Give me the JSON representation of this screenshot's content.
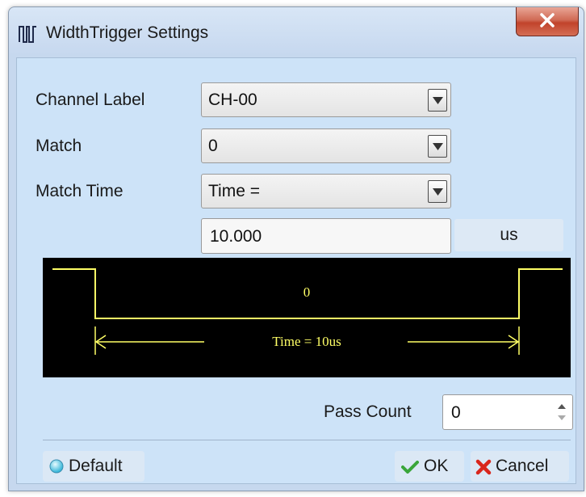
{
  "window": {
    "title": "WidthTrigger Settings"
  },
  "form": {
    "channel_label": {
      "label": "Channel Label",
      "value": "CH-00"
    },
    "match": {
      "label": "Match",
      "value": "0"
    },
    "match_time": {
      "label": "Match Time",
      "value": "Time ="
    },
    "time_value": "10.000",
    "time_unit": "us"
  },
  "diagram": {
    "level_label": "0",
    "time_label": "Time = 10us",
    "line_color": "#ffff66"
  },
  "pass_count": {
    "label": "Pass Count",
    "value": "0"
  },
  "buttons": {
    "default": "Default",
    "ok": "OK",
    "cancel": "Cancel"
  },
  "colors": {
    "client_bg": "#cde3f8",
    "close_red": "#c1432b",
    "ok_green": "#3aa63a",
    "cancel_red": "#d9261c"
  }
}
